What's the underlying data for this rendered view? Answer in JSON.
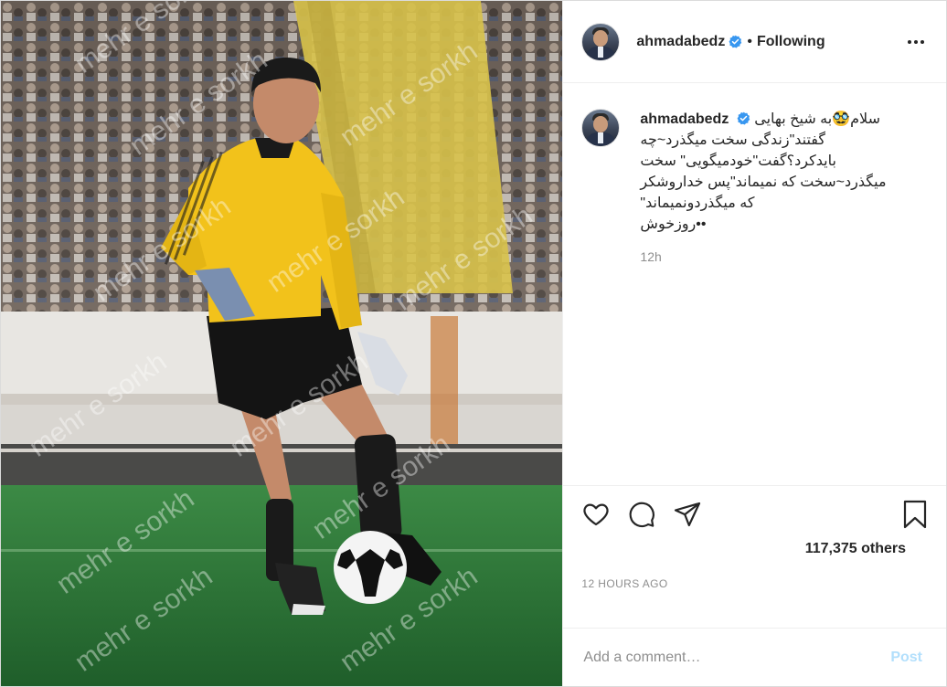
{
  "post": {
    "username": "ahmadabedz",
    "follow_status": "Following",
    "caption_user": "ahmadabedz",
    "caption_lines": [
      "سلام🥸به شیخ بهایی",
      "گفتند\"زندگی سخت میگذرد~چه",
      "بایدکرد؟گفت\"خودمیگویی\" سخت",
      "میگذرد~سخت که نمیماند\"پس خداروشکر",
      "\"که میگذردونمیماند",
      "روزخوش••"
    ],
    "caption_time": "12h",
    "likes_text": "117,375 others",
    "timestamp": "12 HOURS AGO",
    "comment_placeholder": "Add a comment…",
    "post_button": "Post",
    "watermark": "mehr e sorkh"
  },
  "colors": {
    "verified": "#3897f0",
    "post_button": "#b2dffc",
    "muted": "#8e8e8e",
    "jersey": "#f2c21b",
    "pitch": "#2f7d3a"
  },
  "icons": [
    "verified-badge-icon",
    "more-options-icon",
    "heart-icon",
    "comment-icon",
    "share-icon",
    "bookmark-icon"
  ]
}
